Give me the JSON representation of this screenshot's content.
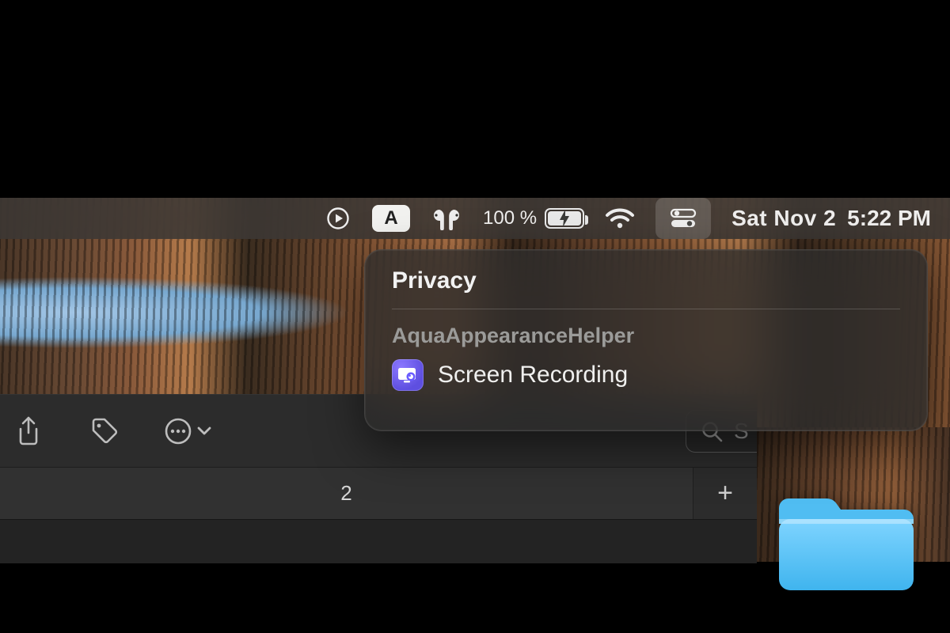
{
  "menubar": {
    "text_input_label": "A",
    "battery_percent_text": "100 %",
    "date_text": "Sat Nov 2",
    "time_text": "5:22 PM"
  },
  "popover": {
    "title": "Privacy",
    "app_name": "AquaAppearanceHelper",
    "item_label": "Screen Recording"
  },
  "finder": {
    "search_visible_text": "S",
    "tab_label": "2",
    "new_tab_glyph": "+"
  }
}
